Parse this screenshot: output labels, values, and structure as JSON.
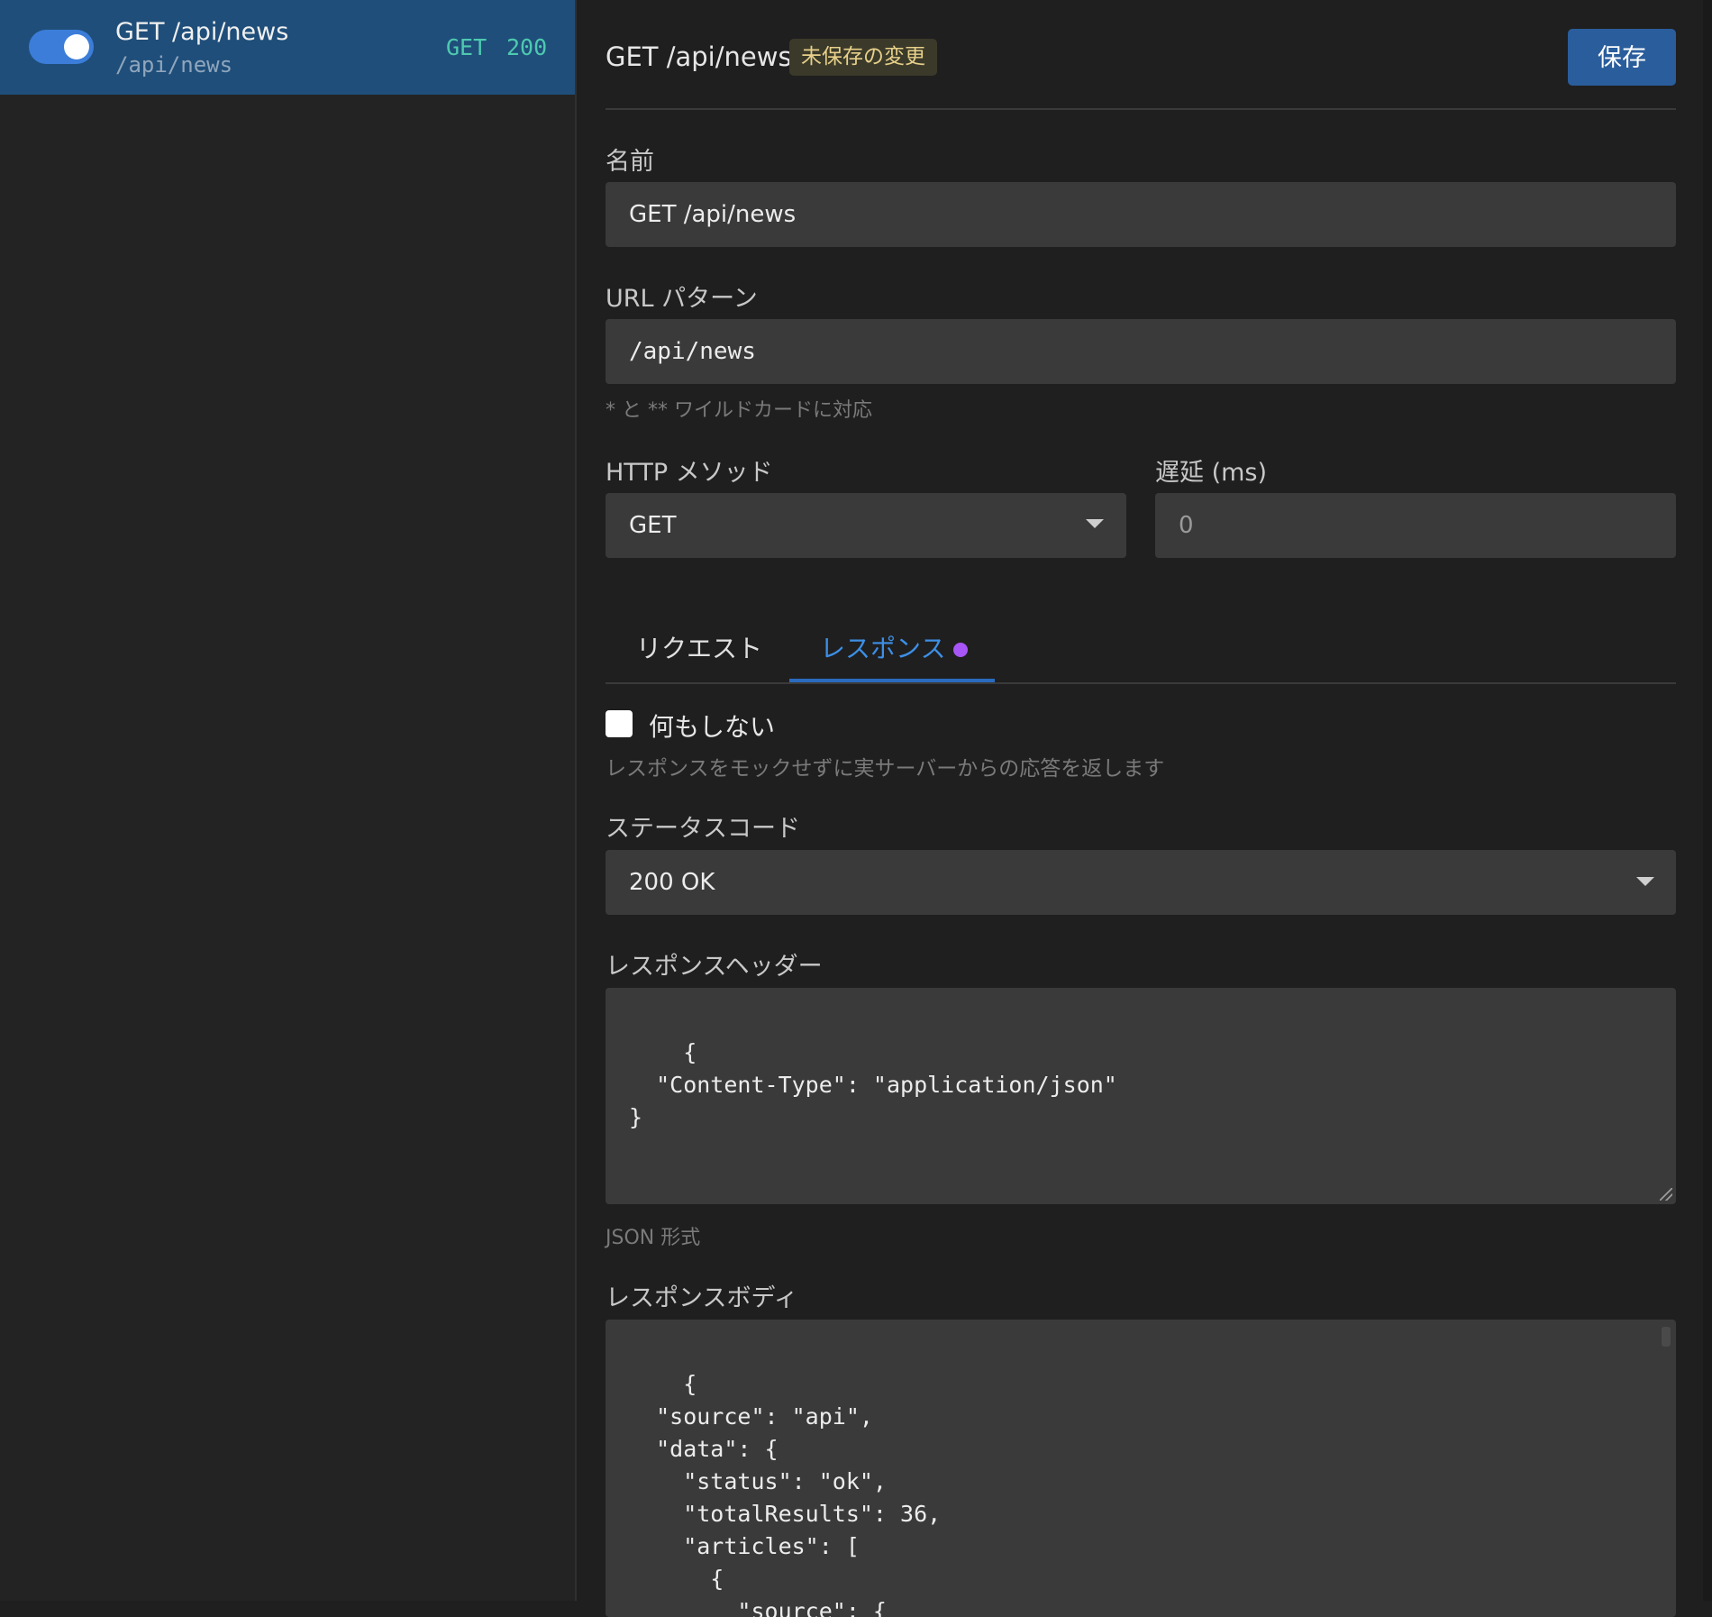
{
  "sidebar": {
    "rule": {
      "enabled": true,
      "name": "GET /api/news",
      "url": "/api/news",
      "method": "GET",
      "status": "200"
    }
  },
  "header": {
    "title": "GET /api/news",
    "badge": "未保存の変更",
    "save_label": "保存"
  },
  "form": {
    "name_label": "名前",
    "name_value": "GET /api/news",
    "url_label": "URL パターン",
    "url_value": "/api/news",
    "url_hint": "* と ** ワイルドカードに対応",
    "method_label": "HTTP メソッド",
    "method_value": "GET",
    "delay_label": "遅延 (ms)",
    "delay_value": "0"
  },
  "tabs": [
    {
      "label": "リクエスト",
      "active": false
    },
    {
      "label": "レスポンス",
      "active": true,
      "modified": true
    }
  ],
  "response": {
    "passthrough_label": "何もしない",
    "passthrough_checked": false,
    "passthrough_hint": "レスポンスをモックせずに実サーバーからの応答を返します",
    "status_label": "ステータスコード",
    "status_value": "200 OK",
    "headers_label": "レスポンスヘッダー",
    "headers_value": "{\n  \"Content-Type\": \"application/json\"\n}",
    "headers_hint": "JSON 形式",
    "body_label": "レスポンスボディ",
    "body_value": "{\n  \"source\": \"api\",\n  \"data\": {\n    \"status\": \"ok\",\n    \"totalResults\": 36,\n    \"articles\": [\n      {\n        \"source\": {"
  },
  "colors": {
    "accent": "#2a5d9c",
    "selected_row": "#1f4e7a",
    "method_status": "#4ec9b0",
    "active_tab": "#3d8fe6",
    "modified_dot": "#a855f7",
    "badge_text": "#e7d08a"
  }
}
